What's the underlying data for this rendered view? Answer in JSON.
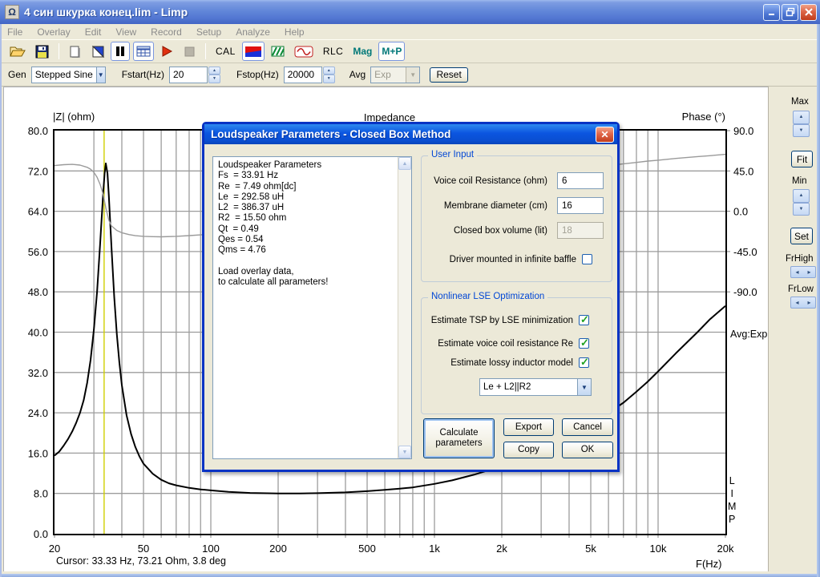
{
  "window": {
    "title": "4 син шкурка конец.lim - Limp"
  },
  "menu": {
    "items": [
      "File",
      "Overlay",
      "Edit",
      "View",
      "Record",
      "Setup",
      "Analyze",
      "Help"
    ]
  },
  "toolbar": {
    "cal_label": "CAL",
    "rlc_label": "RLC",
    "mag_label": "Mag",
    "mp_label": "M+P"
  },
  "gen_bar": {
    "gen_label": "Gen",
    "generator": "Stepped Sine",
    "fstart_label": "Fstart(Hz)",
    "fstart": "20",
    "fstop_label": "Fstop(Hz)",
    "fstop": "20000",
    "avg_label": "Avg",
    "avg": "Exp",
    "reset_label": "Reset"
  },
  "right_panel": {
    "max_label": "Max",
    "fit_label": "Fit",
    "min_label": "Min",
    "set_label": "Set",
    "frhigh_label": "FrHigh",
    "frlow_label": "FrLow",
    "avg_mode": "Avg:Exp"
  },
  "watermark": [
    "L",
    "I",
    "M",
    "P"
  ],
  "status": {
    "cursor_text": "Cursor: 33.33 Hz, 73.21 Ohm, 3.8 deg"
  },
  "dialog": {
    "title": "Loudspeaker Parameters - Closed Box Method",
    "report_lines": [
      "Loudspeaker Parameters",
      "Fs  = 33.91 Hz",
      "Re  = 7.49 ohm[dc]",
      "Le  = 292.58 uH",
      "L2  = 386.37 uH",
      "R2  = 15.50 ohm",
      "Qt  = 0.49",
      "Qes = 0.54",
      "Qms = 4.76",
      "",
      "Load overlay data,",
      "to calculate all parameters!"
    ],
    "user_input": {
      "group_label": "User Input",
      "voice_coil_label": "Voice coil Resistance (ohm)",
      "voice_coil_value": "6",
      "membrane_label": "Membrane diameter (cm)",
      "membrane_value": "16",
      "box_volume_label": "Closed box volume (lit)",
      "box_volume_value": "18",
      "baffle_label": "Driver mounted in infinite baffle",
      "baffle_checked": false
    },
    "lse": {
      "group_label": "Nonlinear LSE Optimization",
      "opt1_label": "Estimate TSP by LSE minimization",
      "opt1_checked": true,
      "opt2_label": "Estimate voice coil resistance Re",
      "opt2_checked": true,
      "opt3_label": "Estimate lossy inductor model",
      "opt3_checked": true,
      "model": "Le + L2||R2"
    },
    "buttons": {
      "calculate": "Calculate parameters",
      "export": "Export",
      "cancel": "Cancel",
      "copy": "Copy",
      "ok": "OK"
    }
  },
  "chart_data": {
    "type": "line",
    "title": "Impedance",
    "x_axis": {
      "label": "F(Hz)",
      "scale": "log",
      "min": 20,
      "max": 20000,
      "ticks": [
        20,
        50,
        100,
        200,
        500,
        1000,
        2000,
        5000,
        10000,
        20000
      ],
      "tick_labels": [
        "20",
        "50",
        "100",
        "200",
        "500",
        "1k",
        "2k",
        "5k",
        "10k",
        "20k"
      ],
      "grid_freqs": [
        30,
        40,
        50,
        60,
        70,
        80,
        90,
        100,
        200,
        300,
        400,
        500,
        600,
        700,
        800,
        900,
        1000,
        2000,
        3000,
        4000,
        5000,
        6000,
        7000,
        8000,
        9000,
        10000
      ]
    },
    "y_left": {
      "label": "|Z| (ohm)",
      "min": 0,
      "max": 80,
      "tick_step": 8,
      "tick_labels": [
        "80.0",
        "72.0",
        "64.0",
        "56.0",
        "48.0",
        "40.0",
        "32.0",
        "24.0",
        "16.0",
        "8.0",
        "0.0"
      ]
    },
    "y_right": {
      "label": "Phase (°)",
      "top_value": 90,
      "deg_per_tick": 45,
      "ticks": [
        90,
        45,
        0,
        -45,
        -90
      ],
      "tick_labels": [
        "90.0",
        "45.0",
        "0.0",
        "-45.0",
        "-90.0"
      ]
    },
    "grid": true,
    "cursor": {
      "freq": 33.33,
      "impedance_ohm": 73.21,
      "phase_deg": 3.8,
      "color": "#cfcf00"
    },
    "series": [
      {
        "name": "impedance",
        "axis": "left",
        "color": "#000000",
        "width": 2,
        "points": [
          [
            20,
            15.5
          ],
          [
            21,
            16.3
          ],
          [
            22,
            17.5
          ],
          [
            23,
            18.8
          ],
          [
            24,
            20.3
          ],
          [
            25,
            22
          ],
          [
            26,
            24
          ],
          [
            27,
            26.5
          ],
          [
            28,
            30
          ],
          [
            29,
            34.5
          ],
          [
            30,
            40.5
          ],
          [
            31,
            48
          ],
          [
            32,
            57.5
          ],
          [
            33,
            67.5
          ],
          [
            33.5,
            71.5
          ],
          [
            33.91,
            73.5
          ],
          [
            34.5,
            71.5
          ],
          [
            35,
            67
          ],
          [
            36,
            56.5
          ],
          [
            37,
            47
          ],
          [
            38,
            39.5
          ],
          [
            39,
            34
          ],
          [
            40,
            29.5
          ],
          [
            42,
            23.5
          ],
          [
            44,
            19.8
          ],
          [
            46,
            17.2
          ],
          [
            48,
            15.3
          ],
          [
            50,
            13.9
          ],
          [
            55,
            11.9
          ],
          [
            60,
            10.7
          ],
          [
            65,
            10
          ],
          [
            70,
            9.6
          ],
          [
            80,
            9.1
          ],
          [
            90,
            8.8
          ],
          [
            100,
            8.6
          ],
          [
            120,
            8.3
          ],
          [
            150,
            8.1
          ],
          [
            200,
            8
          ],
          [
            250,
            8
          ],
          [
            300,
            8.05
          ],
          [
            400,
            8.2
          ],
          [
            500,
            8.45
          ],
          [
            600,
            8.7
          ],
          [
            700,
            8.95
          ],
          [
            800,
            9.2
          ],
          [
            1000,
            9.9
          ],
          [
            1200,
            10.6
          ],
          [
            1500,
            11.7
          ],
          [
            2000,
            13.4
          ],
          [
            2500,
            15
          ],
          [
            3000,
            16.6
          ],
          [
            4000,
            19.4
          ],
          [
            5000,
            21.9
          ],
          [
            6000,
            24
          ],
          [
            7000,
            26
          ],
          [
            8000,
            28.2
          ],
          [
            9000,
            30.2
          ],
          [
            10000,
            32.2
          ],
          [
            12000,
            35.8
          ],
          [
            15000,
            40
          ],
          [
            17000,
            42.5
          ],
          [
            20000,
            45.2
          ]
        ]
      },
      {
        "name": "phase",
        "axis": "right",
        "color": "#9a9a9a",
        "width": 1.4,
        "points": [
          [
            20,
            51
          ],
          [
            22,
            52
          ],
          [
            24,
            52.3
          ],
          [
            26,
            51.5
          ],
          [
            28,
            49
          ],
          [
            29,
            47
          ],
          [
            30,
            43.5
          ],
          [
            31,
            38
          ],
          [
            32,
            30
          ],
          [
            33,
            19
          ],
          [
            33.91,
            3.8
          ],
          [
            35,
            -10
          ],
          [
            36,
            -16.5
          ],
          [
            38,
            -21.5
          ],
          [
            40,
            -24
          ],
          [
            43,
            -26
          ],
          [
            46,
            -27.3
          ],
          [
            50,
            -28
          ],
          [
            55,
            -28.4
          ],
          [
            60,
            -28.5
          ],
          [
            70,
            -28
          ],
          [
            80,
            -27.2
          ],
          [
            90,
            -26.4
          ],
          [
            100,
            -25.5
          ],
          [
            120,
            -23.5
          ],
          [
            150,
            -20.5
          ],
          [
            200,
            -16
          ],
          [
            250,
            -12
          ],
          [
            300,
            -8.5
          ],
          [
            400,
            -2
          ],
          [
            500,
            3.5
          ],
          [
            600,
            8
          ],
          [
            700,
            12
          ],
          [
            800,
            15
          ],
          [
            1000,
            20.5
          ],
          [
            1200,
            25
          ],
          [
            1500,
            29.5
          ],
          [
            2000,
            34.5
          ],
          [
            2500,
            38
          ],
          [
            3000,
            41
          ],
          [
            4000,
            45.5
          ],
          [
            5000,
            48.5
          ],
          [
            6000,
            51
          ],
          [
            7000,
            53
          ],
          [
            8000,
            54.5
          ],
          [
            9000,
            56
          ],
          [
            10000,
            57
          ],
          [
            12000,
            59
          ],
          [
            15000,
            61
          ],
          [
            17000,
            62
          ],
          [
            20000,
            63.5
          ]
        ]
      }
    ]
  }
}
